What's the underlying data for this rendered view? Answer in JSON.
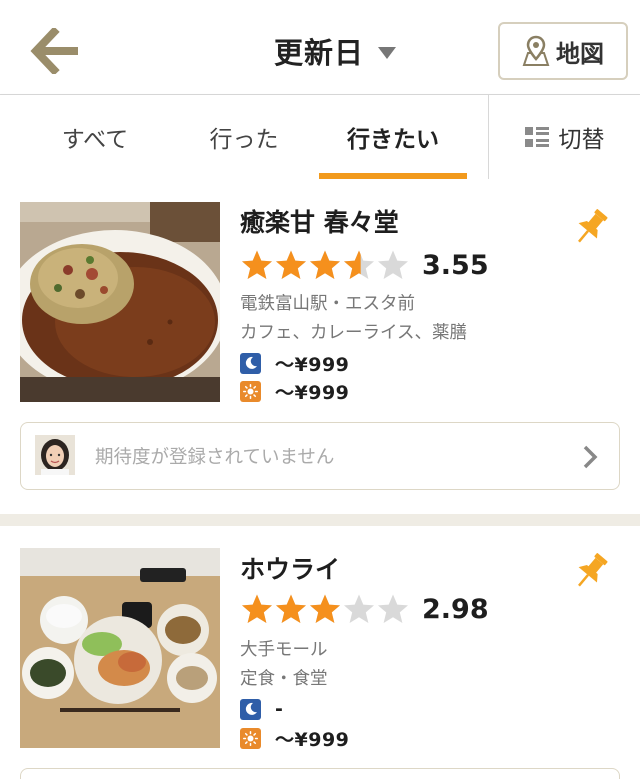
{
  "header": {
    "sort_label": "更新日",
    "map_label": "地図"
  },
  "tabs": [
    {
      "label": "すべて",
      "active": false
    },
    {
      "label": "行った",
      "active": false
    },
    {
      "label": "行きたい",
      "active": true
    }
  ],
  "view_toggle_label": "切替",
  "colors": {
    "accent": "#f29a1d",
    "star_on": "#f5901d",
    "star_off": "#d9d9d9",
    "dinner_icon": "#2f5ea8",
    "lunch_icon": "#e98a2b",
    "pin": "#f5a623"
  },
  "restaurants": [
    {
      "name": "癒楽甘 春々堂",
      "rating": 3.55,
      "score_text": "3.55",
      "area": "電鉄富山駅・エスタ前",
      "genre": "カフェ、カレーライス、薬膳",
      "dinner_price": "〜¥999",
      "lunch_price": "〜¥999",
      "expectation_text": "期待度が登録されていません"
    },
    {
      "name": "ホウライ",
      "rating": 2.98,
      "score_text": "2.98",
      "area": "大手モール",
      "genre": "定食・食堂",
      "dinner_price": "-",
      "lunch_price": "〜¥999"
    }
  ]
}
